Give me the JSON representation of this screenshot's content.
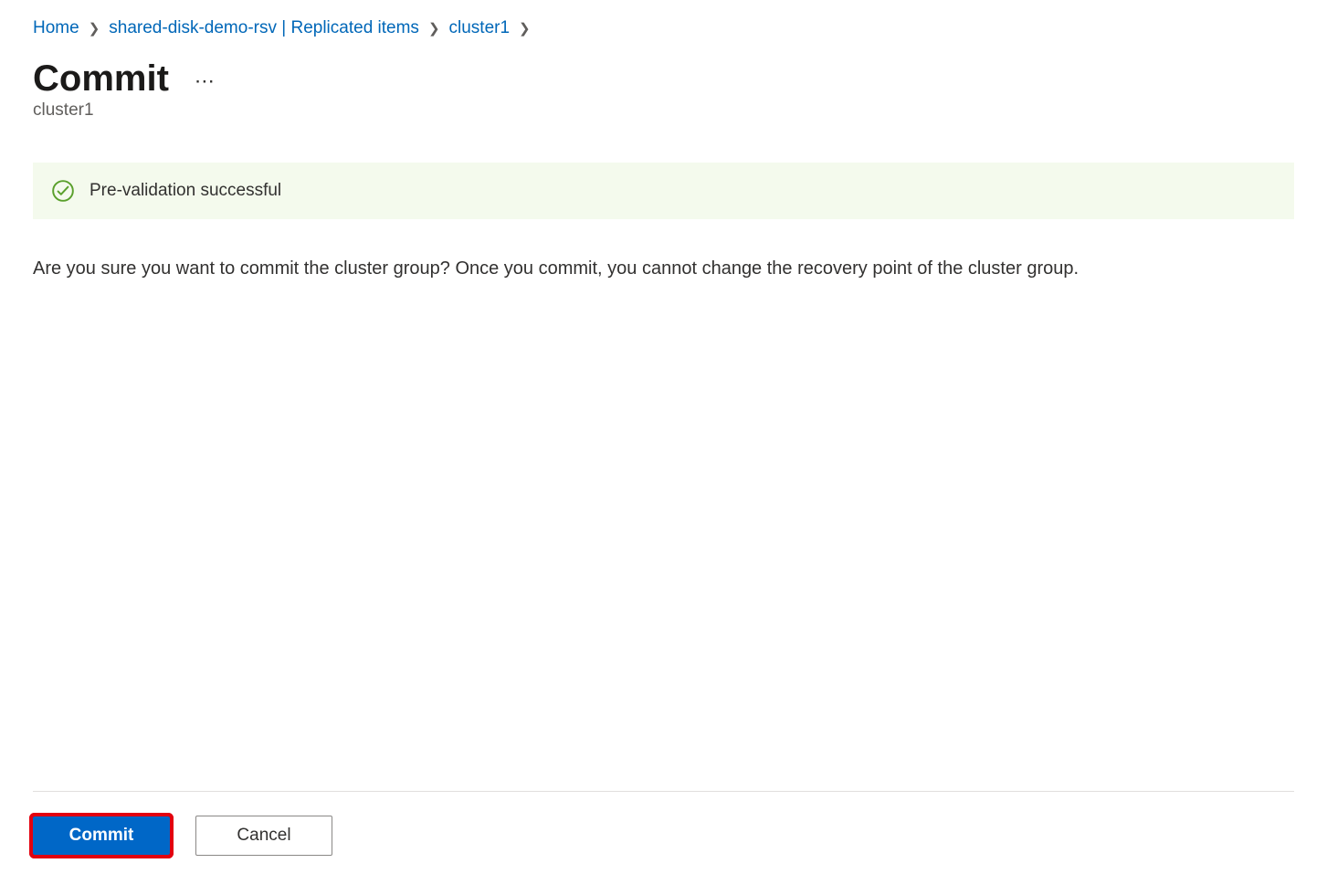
{
  "breadcrumb": {
    "items": [
      {
        "label": "Home"
      },
      {
        "label": "shared-disk-demo-rsv | Replicated items"
      },
      {
        "label": "cluster1"
      }
    ]
  },
  "header": {
    "title": "Commit",
    "subtitle": "cluster1"
  },
  "status": {
    "message": "Pre-validation successful"
  },
  "main": {
    "confirmation_text": "Are you sure you want to commit the cluster group? Once you commit, you cannot change the recovery point of the cluster group."
  },
  "footer": {
    "primary_label": "Commit",
    "secondary_label": "Cancel"
  }
}
